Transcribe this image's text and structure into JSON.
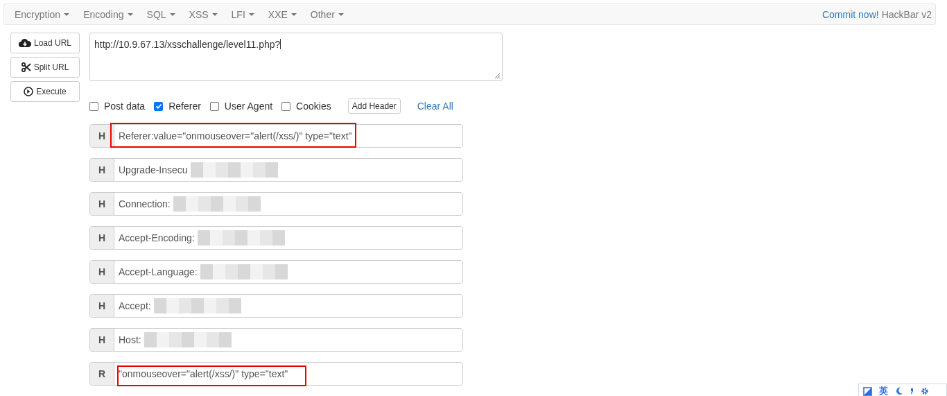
{
  "menu": [
    {
      "label": "Encryption"
    },
    {
      "label": "Encoding"
    },
    {
      "label": "SQL"
    },
    {
      "label": "XSS"
    },
    {
      "label": "LFI"
    },
    {
      "label": "XXE"
    },
    {
      "label": "Other"
    }
  ],
  "commit_link": "Commit now!",
  "brand": "HackBar v2",
  "actions": [
    {
      "label": "Load URL",
      "kind": "load"
    },
    {
      "label": "Split URL",
      "kind": "split"
    },
    {
      "label": "Execute",
      "kind": "execute"
    }
  ],
  "url": "http://10.9.67.13/xsschallenge/level11.php?",
  "options": [
    {
      "label": "Post data",
      "checked": false
    },
    {
      "label": "Referer",
      "checked": true
    },
    {
      "label": "User Agent",
      "checked": false
    },
    {
      "label": "Cookies",
      "checked": false
    }
  ],
  "add_header": "Add Header",
  "clear_all": "Clear All",
  "headers": [
    {
      "prefix": "H",
      "value": "Referer:value=\"onmouseover=\"alert(/xss/)\" type=\"text\"",
      "highlighted": true,
      "redacted": false
    },
    {
      "prefix": "H",
      "value": "Upgrade-Insecu",
      "highlighted": false,
      "redacted": true
    },
    {
      "prefix": "H",
      "value": "Connection:",
      "highlighted": false,
      "redacted": true
    },
    {
      "prefix": "H",
      "value": "Accept-Encoding:",
      "highlighted": false,
      "redacted": true
    },
    {
      "prefix": "H",
      "value": "Accept-Language:",
      "highlighted": false,
      "redacted": true
    },
    {
      "prefix": "H",
      "value": "Accept:",
      "highlighted": false,
      "redacted": true
    },
    {
      "prefix": "H",
      "value": "Host:",
      "highlighted": false,
      "redacted": true
    },
    {
      "prefix": "R",
      "value": "\"onmouseover=\"alert(/xss/)\" type=\"text\"",
      "highlighted": true,
      "redacted": false
    }
  ],
  "ime": {
    "label": "英"
  }
}
